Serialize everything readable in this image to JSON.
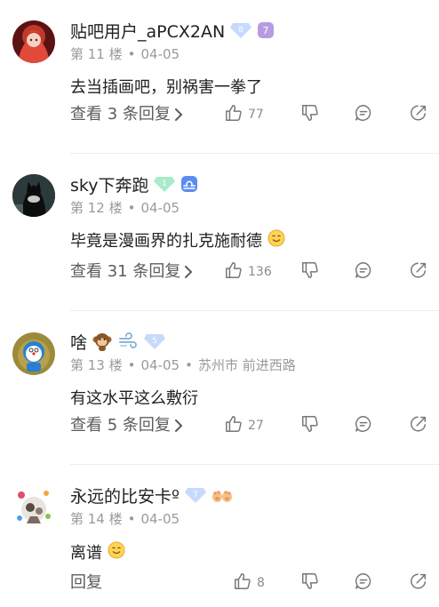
{
  "comments": [
    {
      "username": "贴吧用户_aPCX2AN",
      "floor": "第 11 楼",
      "date": "04-05",
      "text": "去当插画吧，别祸害一拳了",
      "replies": "查看 3 条回复",
      "likes": "77",
      "badges": [
        {
          "icon": "diamond-icon",
          "value": "8",
          "color": "#8fb6f5"
        },
        {
          "icon": "level-icon",
          "value": "7",
          "color": "#b69be3"
        }
      ]
    },
    {
      "username": "sky下奔跑",
      "floor": "第 12 楼",
      "date": "04-05",
      "text": "毕竟是漫画界的扎克施耐德",
      "replies": "查看 31 条回复",
      "likes": "136",
      "badges": [
        {
          "icon": "diamond-icon",
          "value": "1",
          "color": "#8fe0b9"
        },
        {
          "icon": "libra-zodiac-icon",
          "value": "",
          "color": "#5a8cf0"
        }
      ]
    },
    {
      "username": "啥",
      "floor": "第 13 楼",
      "date": "04-05",
      "location": "苏州市 前进西路",
      "text": "有这水平这么敷衍",
      "replies": "查看 5 条回复",
      "likes": "27",
      "badges": [
        {
          "icon": "monkey-emoji-icon",
          "value": ""
        },
        {
          "icon": "wind-emoji-icon",
          "value": ""
        },
        {
          "icon": "diamond-icon",
          "value": "5",
          "color": "#8fb6f5"
        }
      ]
    },
    {
      "username": "永远的比安卡º",
      "floor": "第 14 楼",
      "date": "04-05",
      "text": "离谱",
      "replies": "回复",
      "likes": "8",
      "badges": [
        {
          "icon": "diamond-icon",
          "value": "7",
          "color": "#8fb6f5"
        },
        {
          "icon": "paws-emoji-icon",
          "value": ""
        }
      ]
    }
  ],
  "colors": {
    "text": "#1f1f1f",
    "meta": "#9a9a9a",
    "icon": "#777777",
    "divider": "#ececec"
  }
}
